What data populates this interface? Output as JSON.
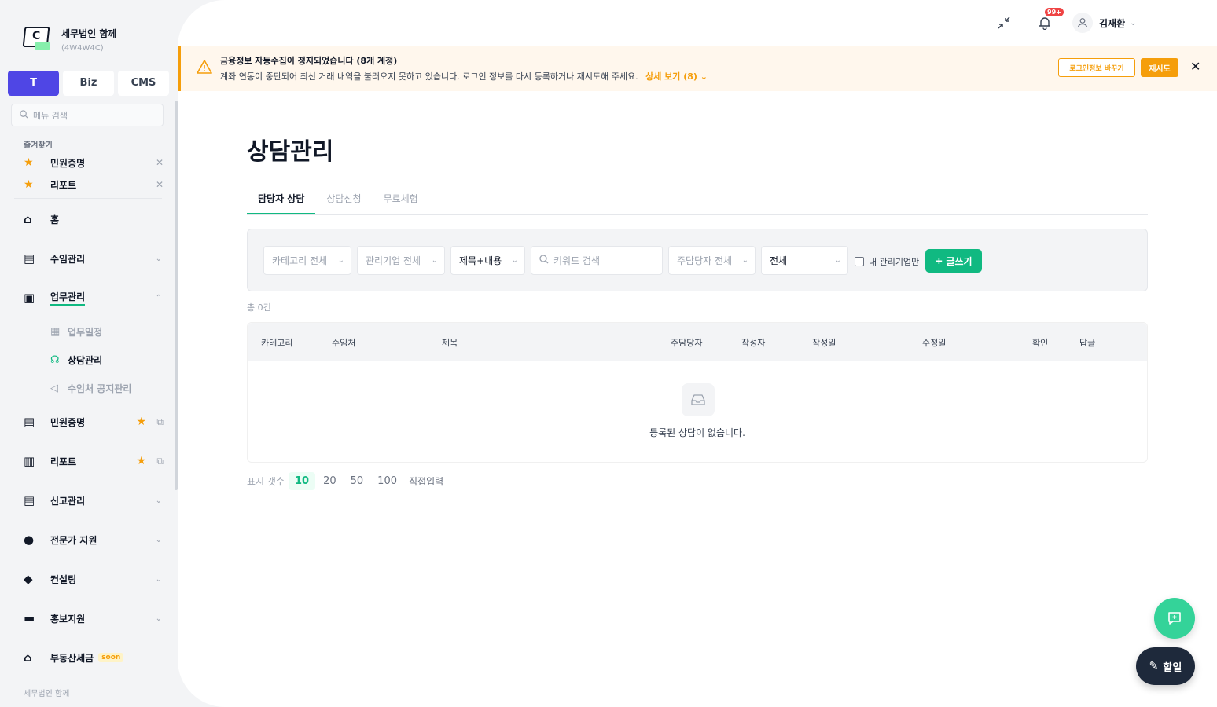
{
  "brand": {
    "name": "세무법인 함께",
    "code": "(4W4W4C)",
    "logo_letter": "C"
  },
  "segments": [
    "T",
    "Biz",
    "CMS"
  ],
  "menu_search": {
    "placeholder": "메뉴 검색"
  },
  "favorites": {
    "title": "즐겨찾기",
    "items": [
      "민원증명",
      "리포트"
    ]
  },
  "nav": {
    "home": "홈",
    "client": "수임관리",
    "work": "업무관리",
    "work_sub": [
      "업무일정",
      "상담관리",
      "수임처 공지관리"
    ],
    "civil": "민원증명",
    "report": "리포트",
    "filing": "신고관리",
    "expert": "전문가 지원",
    "consult": "컨설팅",
    "promo": "홍보지원",
    "realestate": "부동산세금",
    "soon": "soon"
  },
  "sidebar_footer": "세무법인 함께",
  "topbar": {
    "badge": "99+",
    "user_name": "김재환"
  },
  "alert": {
    "title": "금융정보 자동수집이 정지되었습니다 (8개 계정)",
    "message": "계좌 연동이 중단되어 최신 거래 내역을 불러오지 못하고 있습니다. 로그인 정보를 다시 등록하거나 재시도해 주세요.",
    "more": "상세 보기 (8)",
    "btn_change": "로그인정보 바꾸기",
    "btn_retry": "재시도"
  },
  "page": {
    "title": "상담관리",
    "tabs": [
      "담당자 상담",
      "상담신청",
      "무료체험"
    ]
  },
  "filter": {
    "category": "카테고리 전체",
    "company": "관리기업 전체",
    "field": "제목+내용",
    "keyword_placeholder": "키워드 검색",
    "manager": "주담당자 전체",
    "status": "전체",
    "mine_only": "내 관리기업만",
    "write": "글쓰기"
  },
  "count": "총 0건",
  "table": {
    "headers": [
      "카테고리",
      "수임처",
      "제목",
      "주담당자",
      "작성자",
      "작성일",
      "수정일",
      "확인",
      "답글"
    ],
    "empty": "등록된 상담이 없습니다."
  },
  "pager": {
    "label": "표시 갯수",
    "sizes": [
      "10",
      "20",
      "50",
      "100"
    ],
    "active": "10",
    "custom": "직접입력"
  },
  "fab": {
    "todo": "할일"
  },
  "colors": {
    "accent": "#10b981",
    "primary": "#4f46e5",
    "warning": "#f59e0b"
  }
}
